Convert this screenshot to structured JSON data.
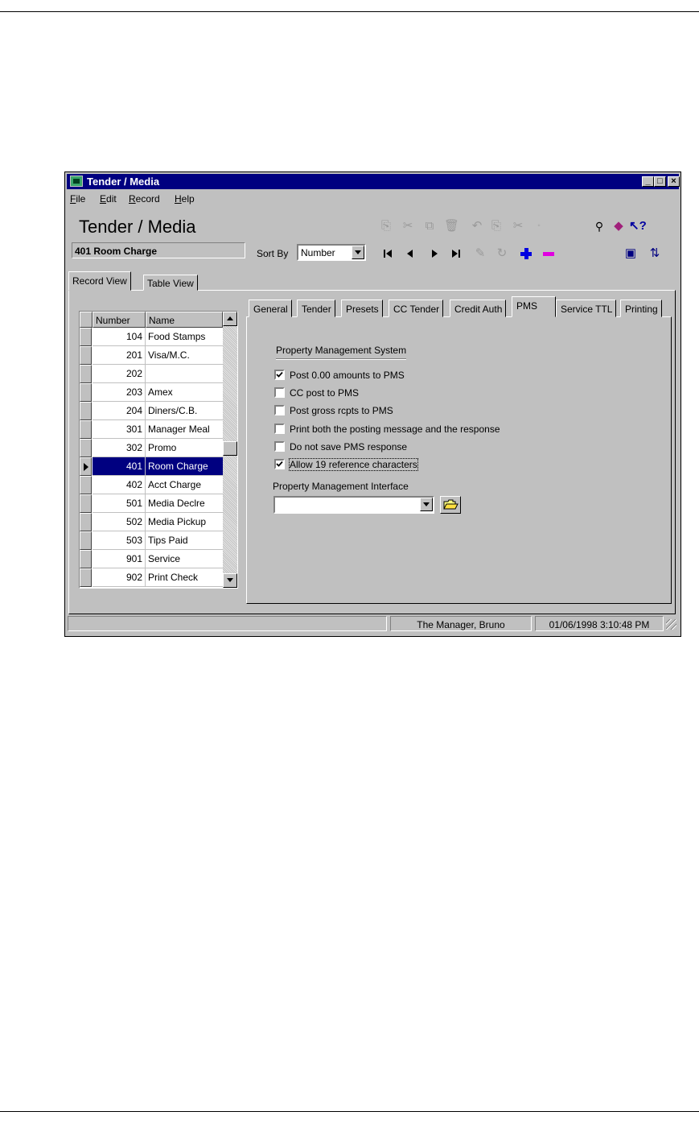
{
  "window": {
    "title": "Tender / Media",
    "controls": {
      "minimize": "_",
      "maximize": "□",
      "close": "×"
    }
  },
  "menu": [
    {
      "label": "File",
      "hotkey": "F",
      "rest": "ile"
    },
    {
      "label": "Edit",
      "hotkey": "E",
      "rest": "dit"
    },
    {
      "label": "Record",
      "hotkey": "R",
      "rest": "ecord"
    },
    {
      "label": "Help",
      "hotkey": "H",
      "rest": "elp"
    }
  ],
  "form": {
    "title": "Tender / Media",
    "current_record": "401 Room Charge",
    "sort_by_label": "Sort By",
    "sort_by_value": "Number"
  },
  "toolbar": {
    "icons": [
      "copy-record-icon",
      "cut-icon",
      "paste-icon",
      "delete-icon",
      "undo-icon",
      "copy-field-icon",
      "paste-field-icon",
      "clear-icon",
      "find-icon",
      "help-book-icon",
      "context-help-icon",
      "first-record-icon",
      "prev-record-icon",
      "next-record-icon",
      "last-record-icon",
      "edit-icon",
      "revert-icon",
      "add-record-icon",
      "delete-record-icon",
      "view-icon",
      "refresh-icon"
    ]
  },
  "outer_tabs": [
    "Record View",
    "Table View"
  ],
  "grid": {
    "columns": [
      "Number",
      "Name"
    ],
    "rows": [
      {
        "number": "104",
        "name": "Food Stamps"
      },
      {
        "number": "201",
        "name": "Visa/M.C."
      },
      {
        "number": "202",
        "name": ""
      },
      {
        "number": "203",
        "name": "Amex"
      },
      {
        "number": "204",
        "name": "Diners/C.B."
      },
      {
        "number": "301",
        "name": "Manager Meal"
      },
      {
        "number": "302",
        "name": "Promo"
      },
      {
        "number": "401",
        "name": "Room Charge"
      },
      {
        "number": "402",
        "name": "Acct Charge"
      },
      {
        "number": "501",
        "name": "Media Declre"
      },
      {
        "number": "502",
        "name": "Media Pickup"
      },
      {
        "number": "503",
        "name": "Tips Paid"
      },
      {
        "number": "901",
        "name": "Service"
      },
      {
        "number": "902",
        "name": "Print Check"
      }
    ],
    "selected_number": "401"
  },
  "inner_tabs": [
    "General",
    "Tender",
    "Presets",
    "CC Tender",
    "Credit Auth",
    "PMS",
    "Service TTL",
    "Printing"
  ],
  "active_inner_tab": "PMS",
  "pms": {
    "group_label": "Property Management System",
    "options": [
      {
        "label": "Post 0.00 amounts to PMS",
        "checked": true
      },
      {
        "label": "CC post to PMS",
        "checked": false
      },
      {
        "label": "Post gross rcpts to PMS",
        "checked": false
      },
      {
        "label": "Print both the posting message and the response",
        "checked": false
      },
      {
        "label": "Do not save PMS response",
        "checked": false
      },
      {
        "label": "Allow 19 reference characters",
        "checked": true
      }
    ],
    "interface_label": "Property Management Interface",
    "interface_value": ""
  },
  "status": {
    "user": "The Manager, Bruno",
    "datetime": "01/06/1998 3:10:48 PM"
  }
}
